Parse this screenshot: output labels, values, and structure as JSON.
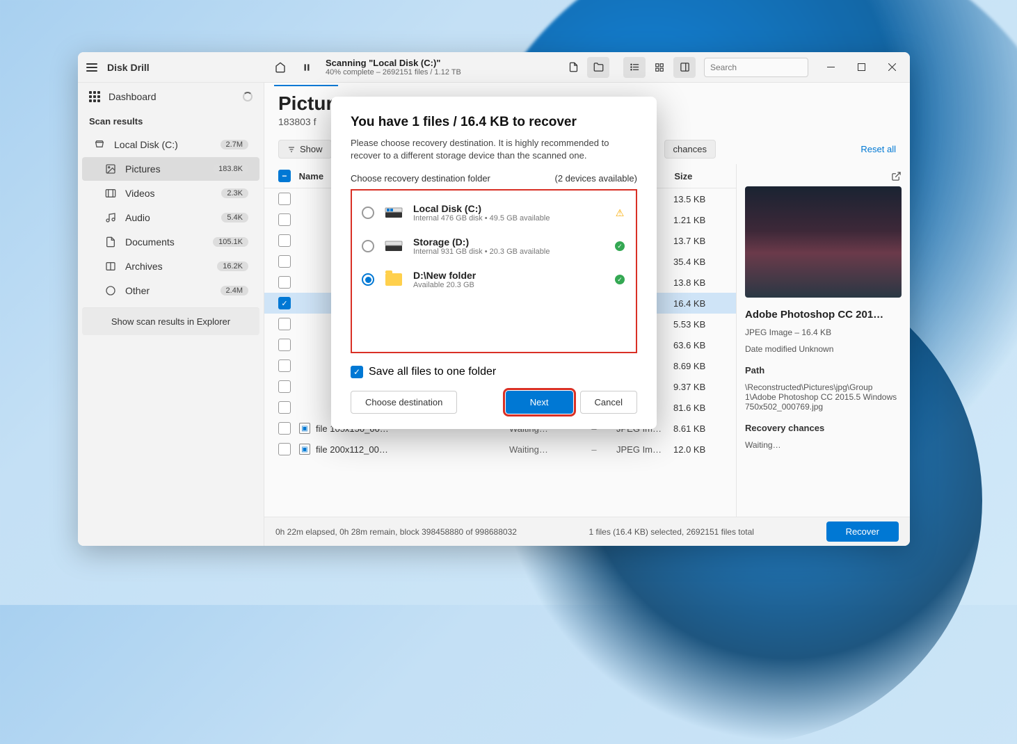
{
  "app": {
    "title": "Disk Drill"
  },
  "titlebar": {
    "scan_title": "Scanning \"Local Disk (C:)\"",
    "scan_sub": "40% complete – 2692151 files / 1.12 TB",
    "search_placeholder": "Search"
  },
  "sidebar": {
    "dashboard": "Dashboard",
    "section": "Scan results",
    "items": [
      {
        "icon": "disk",
        "label": "Local Disk (C:)",
        "badge": "2.7M"
      },
      {
        "icon": "image",
        "label": "Pictures",
        "badge": "183.8K",
        "selected": true
      },
      {
        "icon": "video",
        "label": "Videos",
        "badge": "2.3K"
      },
      {
        "icon": "audio",
        "label": "Audio",
        "badge": "5.4K"
      },
      {
        "icon": "doc",
        "label": "Documents",
        "badge": "105.1K"
      },
      {
        "icon": "archive",
        "label": "Archives",
        "badge": "16.2K"
      },
      {
        "icon": "other",
        "label": "Other",
        "badge": "2.4M"
      }
    ],
    "footer": "Show scan results in Explorer"
  },
  "main": {
    "title": "Pictur",
    "subtitle": "183803 f",
    "show_filter": "Show",
    "chances_filter": "chances",
    "reset": "Reset all",
    "columns": {
      "name": "Name",
      "size": "Size"
    }
  },
  "rows": [
    {
      "size": "13.5 KB"
    },
    {
      "size": "1.21 KB"
    },
    {
      "size": "13.7 KB"
    },
    {
      "size": "35.4 KB"
    },
    {
      "size": "13.8 KB"
    },
    {
      "size": "16.4 KB",
      "selected": true,
      "checked": true
    },
    {
      "size": "5.53 KB"
    },
    {
      "size": "63.6 KB"
    },
    {
      "size": "8.69 KB"
    },
    {
      "size": "9.37 KB"
    },
    {
      "size": "81.6 KB"
    },
    {
      "size": "8.61 KB",
      "name": "file 105x150_00…",
      "status": "Waiting…",
      "type": "JPEG Im…"
    },
    {
      "size": "12.0 KB",
      "name": "file 200x112_00…",
      "status": "Waiting…",
      "type": "JPEG Im…"
    }
  ],
  "details": {
    "title": "Adobe Photoshop CC 201…",
    "type": "JPEG Image – 16.4 KB",
    "modified": "Date modified Unknown",
    "path_label": "Path",
    "path": "\\Reconstructed\\Pictures\\jpg\\Group 1\\Adobe Photoshop CC 2015.5 Windows 750x502_000769.jpg",
    "chances_label": "Recovery chances",
    "chances": "Waiting…"
  },
  "statusbar": {
    "elapsed": "0h 22m elapsed, 0h 28m remain, block 398458880 of 998688032",
    "selected": "1 files (16.4 KB) selected, 2692151 files total",
    "recover": "Recover"
  },
  "modal": {
    "heading": "You have 1 files / 16.4 KB to recover",
    "desc": "Please choose recovery destination. It is highly recommended to recover to a different storage device than the scanned one.",
    "choose_label": "Choose recovery destination folder",
    "devices_label": "(2 devices available)",
    "destinations": [
      {
        "name": "Local Disk (C:)",
        "sub": "Internal 476 GB disk • 49.5 GB available",
        "status": "warn"
      },
      {
        "name": "Storage (D:)",
        "sub": "Internal 931 GB disk • 20.3 GB available",
        "status": "ok"
      },
      {
        "name": "D:\\New folder",
        "sub": "Available 20.3 GB",
        "status": "ok",
        "selected": true,
        "folder": true
      }
    ],
    "save_all": "Save all files to one folder",
    "choose_btn": "Choose destination",
    "next_btn": "Next",
    "cancel_btn": "Cancel"
  }
}
